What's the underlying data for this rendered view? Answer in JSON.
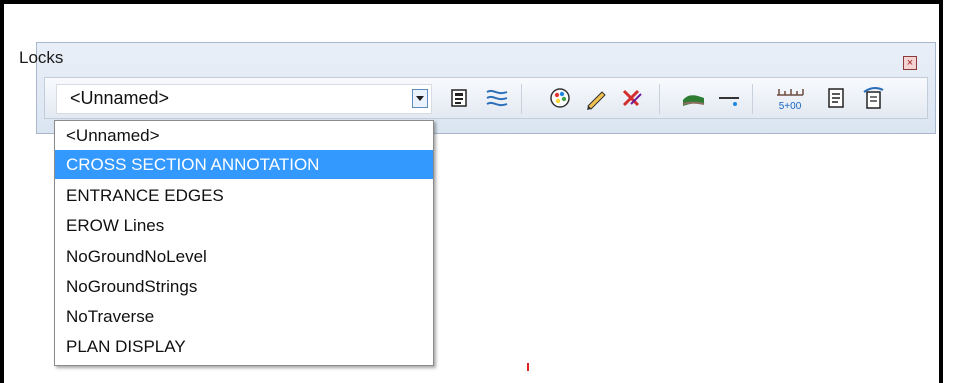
{
  "window": {
    "title": "Locks",
    "close_symbol": "×"
  },
  "combo": {
    "value": "<Unnamed>"
  },
  "toolbar": {
    "icons": [
      "style-icon",
      "traverse-icon",
      "palette-icon",
      "pencil-icon",
      "delete-icon",
      "terrain-icon",
      "line-icon",
      "station-icon",
      "report-icon",
      "profile-icon"
    ],
    "station_text": "5+00"
  },
  "dropdown": {
    "items": [
      "<Unnamed>",
      "CROSS SECTION ANNOTATION",
      "ENTRANCE EDGES",
      "EROW Lines",
      "NoGroundNoLevel",
      "NoGroundStrings",
      "NoTraverse",
      "PLAN DISPLAY"
    ],
    "selected_index": 1
  },
  "colors": {
    "selection": "#3399ff",
    "accent": "#e02020"
  }
}
